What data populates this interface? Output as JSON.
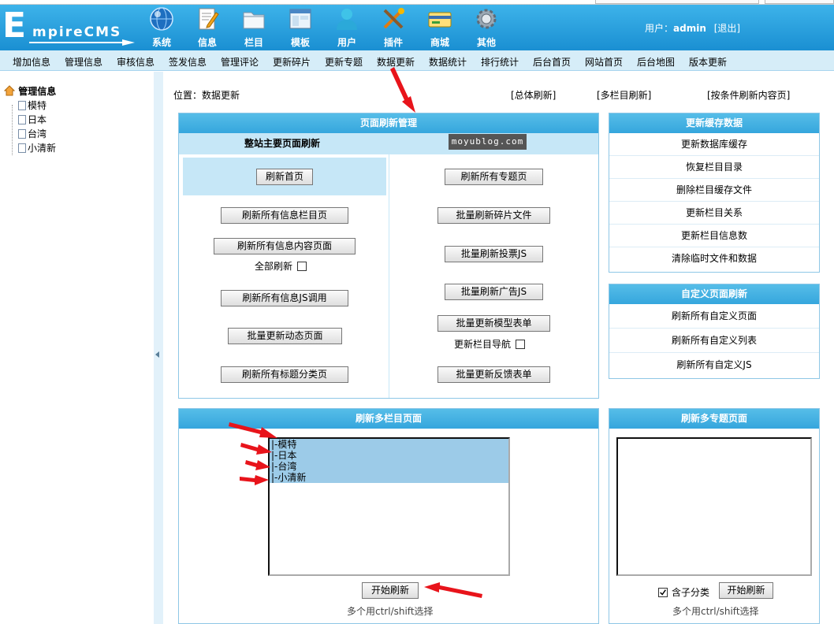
{
  "logo": {
    "initial": "E",
    "text": "mpireCMS"
  },
  "top_nav": [
    {
      "label": "系统",
      "icon": "globe-icon"
    },
    {
      "label": "信息",
      "icon": "document-edit-icon"
    },
    {
      "label": "栏目",
      "icon": "folder-icon"
    },
    {
      "label": "模板",
      "icon": "template-window-icon"
    },
    {
      "label": "用户",
      "icon": "user-icon"
    },
    {
      "label": "插件",
      "icon": "plugin-tools-icon"
    },
    {
      "label": "商城",
      "icon": "shop-card-icon"
    },
    {
      "label": "其他",
      "icon": "gear-icon"
    }
  ],
  "user": {
    "prefix": "用户：",
    "name": "admin",
    "logout": "[退出]"
  },
  "menu": [
    "增加信息",
    "管理信息",
    "审核信息",
    "签发信息",
    "管理评论",
    "更新碎片",
    "更新专题",
    "数据更新",
    "数据统计",
    "排行统计",
    "后台首页",
    "网站首页",
    "后台地图",
    "版本更新"
  ],
  "tree": {
    "root": "管理信息",
    "children": [
      "模特",
      "日本",
      "台湾",
      "小清新"
    ]
  },
  "position": {
    "text": "位置：数据更新"
  },
  "top_links": [
    "[总体刷新]",
    "[多栏目刷新]",
    "[按条件刷新内容页]"
  ],
  "page_refresh": {
    "title": "页面刷新管理",
    "subtitle": "整站主要页面刷新",
    "watermark": "moyublog.com",
    "left_buttons": [
      "刷新首页",
      "刷新所有信息栏目页",
      "刷新所有信息内容页面",
      "刷新所有信息JS调用",
      "批量更新动态页面",
      "刷新所有标题分类页"
    ],
    "full_refresh_label": "全部刷新",
    "right_buttons": [
      "刷新所有专题页",
      "批量刷新碎片文件",
      "批量刷新投票JS",
      "批量刷新广告JS",
      "批量更新模型表单",
      "批量更新反馈表单"
    ],
    "nav_update_label": "更新栏目导航"
  },
  "cache_panel": {
    "title": "更新缓存数据",
    "links": [
      "更新数据库缓存",
      "恢复栏目目录",
      "删除栏目缓存文件",
      "更新栏目关系",
      "更新栏目信息数",
      "清除临时文件和数据"
    ]
  },
  "custom_panel": {
    "title": "自定义页面刷新",
    "links": [
      "刷新所有自定义页面",
      "刷新所有自定义列表",
      "刷新所有自定义JS"
    ]
  },
  "multi_column": {
    "title": "刷新多栏目页面",
    "options": [
      "|-模特",
      "|-日本",
      "|-台湾",
      "|-小清新"
    ],
    "button": "开始刷新",
    "hint": "多个用ctrl/shift选择"
  },
  "multi_topic": {
    "title": "刷新多专题页面",
    "checkbox_label": "含子分类",
    "checkbox_checked": true,
    "button": "开始刷新",
    "hint": "多个用ctrl/shift选择"
  },
  "colors": {
    "header": "#2aa0dc",
    "panel_header": "#45b2e3",
    "menubar": "#d6edf8",
    "annotation_arrow": "#e8141b",
    "selected_option": "#9ccbe8"
  }
}
